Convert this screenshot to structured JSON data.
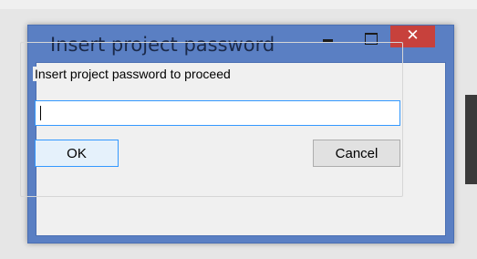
{
  "window": {
    "title": "Insert project password",
    "close_glyph": "✕",
    "controls": [
      "minimize-icon",
      "maximize-icon",
      "close-icon"
    ]
  },
  "dialog": {
    "group_label": "Insert project password to proceed",
    "password_value": "",
    "ok_label": "OK",
    "cancel_label": "Cancel"
  },
  "colors": {
    "titlebar": "#5a7fc3",
    "close_button": "#c7413c",
    "focus_border": "#3399ff"
  }
}
